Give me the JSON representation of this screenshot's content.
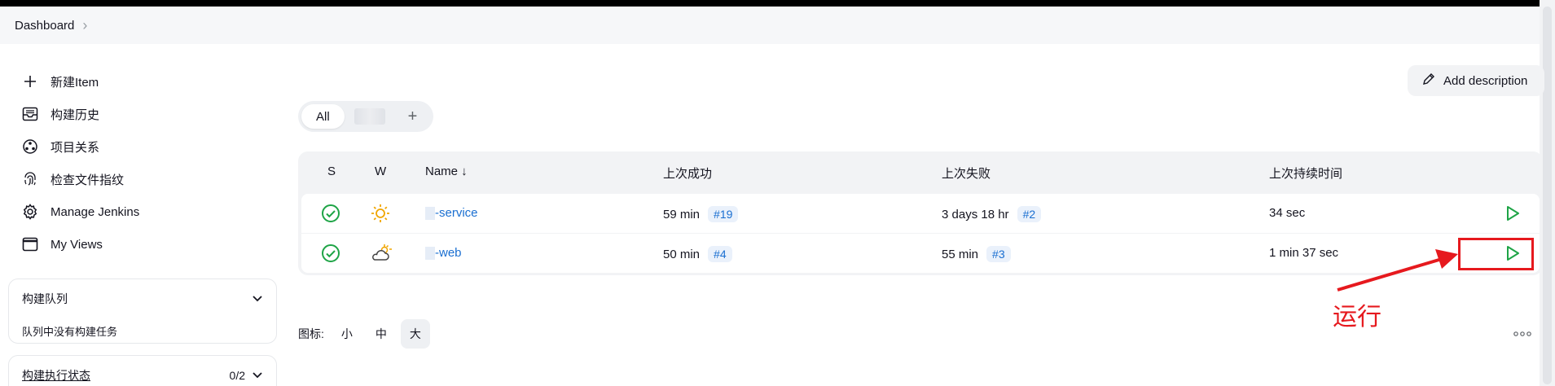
{
  "breadcrumb": {
    "root": "Dashboard",
    "separator": "›"
  },
  "sidebar": {
    "tasks": [
      {
        "label": "新建Item",
        "icon": "plus-icon"
      },
      {
        "label": "构建历史",
        "icon": "inbox-history-icon"
      },
      {
        "label": "项目关系",
        "icon": "relationship-icon"
      },
      {
        "label": "检查文件指纹",
        "icon": "fingerprint-icon"
      },
      {
        "label": "Manage Jenkins",
        "icon": "gear-icon"
      },
      {
        "label": "My Views",
        "icon": "window-icon"
      }
    ],
    "queue": {
      "title": "构建队列",
      "empty": "队列中没有构建任务"
    },
    "executors": {
      "title": "构建执行状态",
      "count": "0/2"
    }
  },
  "add_description": "Add description",
  "views": {
    "tabs": [
      {
        "label": "All",
        "active": true
      },
      {
        "label": "",
        "blurred": true
      }
    ],
    "add": "+"
  },
  "table": {
    "headers": {
      "s": "S",
      "w": "W",
      "name": "Name ↓",
      "last_success": "上次成功",
      "last_failure": "上次失败",
      "last_duration": "上次持续时间"
    },
    "rows": [
      {
        "name": "-service",
        "weather": "sunny",
        "success_time": "59 min",
        "success_build": "#19",
        "failure_time": "3 days 18 hr",
        "failure_build": "#2",
        "duration": "34 sec"
      },
      {
        "name": "-web",
        "weather": "partly-cloudy",
        "success_time": "50 min",
        "success_build": "#4",
        "failure_time": "55 min",
        "failure_build": "#3",
        "duration": "1 min 37 sec"
      }
    ]
  },
  "icon_size": {
    "label": "图标:",
    "options": [
      "小",
      "中",
      "大"
    ],
    "selected": "大"
  },
  "annotation": {
    "text": "运行",
    "color": "#e6191e"
  },
  "colors": {
    "link": "#1a6fd1",
    "success": "#1ea446",
    "annotation": "#e6191e"
  }
}
